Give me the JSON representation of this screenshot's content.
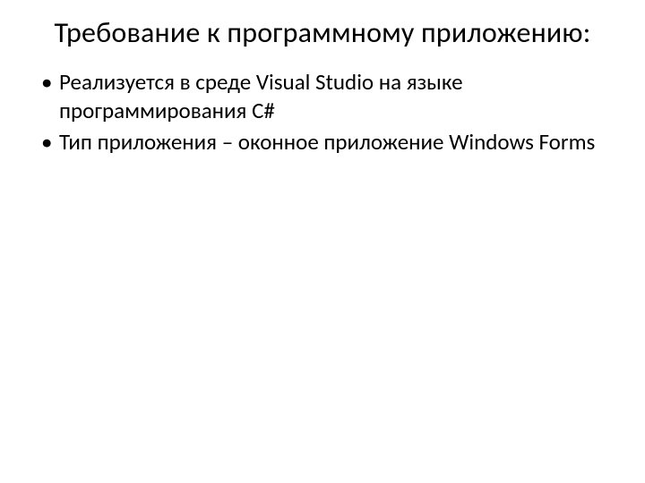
{
  "slide": {
    "title": "Требование к программному приложению:",
    "bullets": [
      "Реализуется в среде Visual Studio на языке программирования C#",
      "Тип приложения – оконное приложение Windows Forms"
    ]
  }
}
